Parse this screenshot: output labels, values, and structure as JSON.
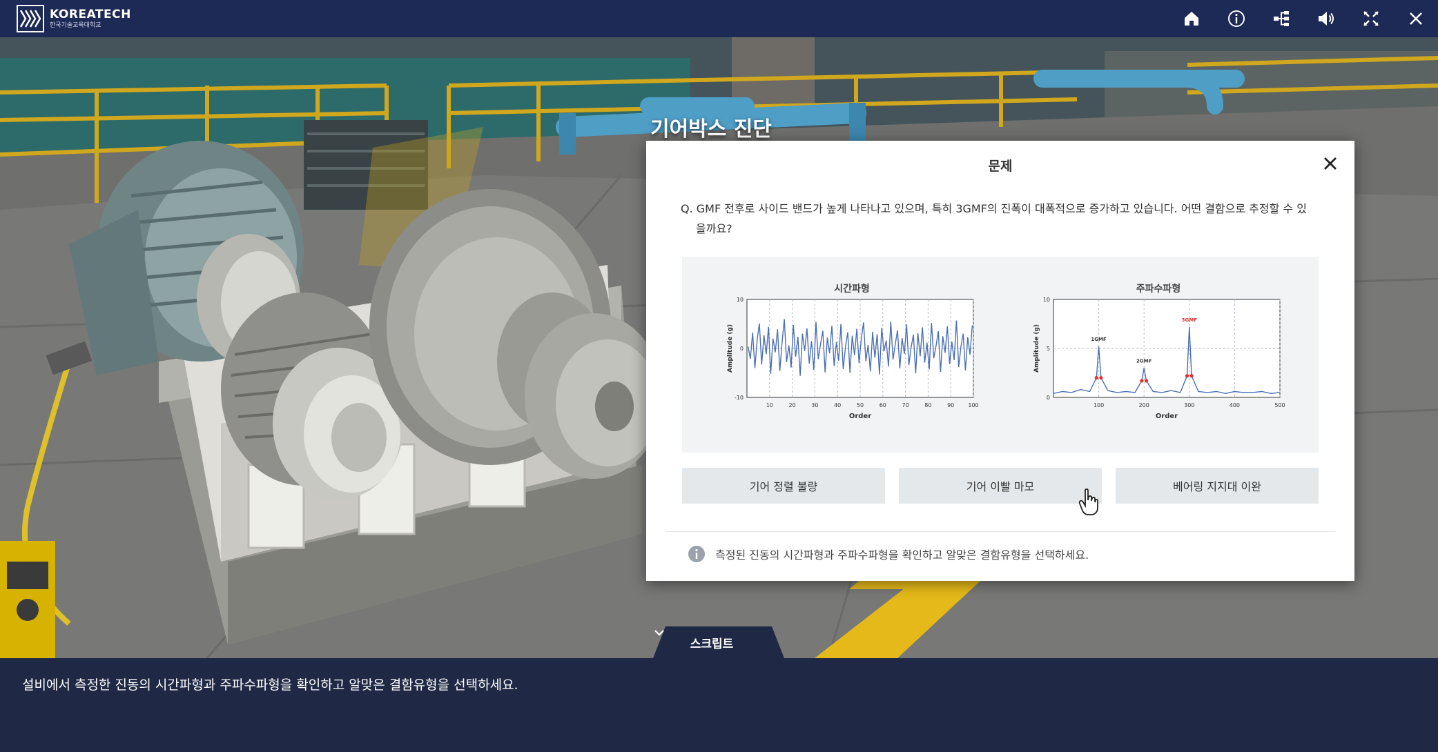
{
  "header": {
    "logo_name": "KOREATECH",
    "logo_sub": "한국기술교육대학교",
    "icons": [
      "home-icon",
      "info-icon",
      "sitemap-icon",
      "volume-icon",
      "fullscreen-icon",
      "close-icon"
    ]
  },
  "scene": {
    "title": "기어박스 진단"
  },
  "dialog": {
    "title": "문제",
    "question": "Q. GMF 전후로 사이드 밴드가 높게 나타나고 있으며, 특히 3GMF의 진폭이 대폭적으로 증가하고 있습니다. 어떤 결함으로 추정할 수 있을까요?",
    "options": [
      "기어 정렬 불량",
      "기어 이빨 마모",
      "베어링 지지대 이완"
    ],
    "hint": "측정된 진동의 시간파형과 주파수파형을 확인하고 알맞은 결함유형을 선택하세요."
  },
  "script": {
    "tab_label": "스크립트",
    "subtitle": "설비에서 측정한 진동의 시간파형과 주파수파형을 확인하고 알맞은 결함유형을 선택하세요."
  },
  "colors": {
    "header_bg": "#1e2a56",
    "signal": "#4a6fb5",
    "peak_marker": "#e03030"
  },
  "chart_data": [
    {
      "type": "line",
      "title": "시간파형",
      "xlabel": "Order",
      "ylabel": "Amplitude (g)",
      "xlim": [
        0,
        100
      ],
      "ylim": [
        -10,
        10
      ],
      "x_ticks": [
        "10",
        "20",
        "30",
        "40",
        "50",
        "60",
        "70",
        "80",
        "90",
        "100"
      ],
      "y_ticks": [
        "10",
        "0",
        "-10"
      ],
      "grid": true,
      "series": [
        {
          "values": [
            0.4,
            -2.1,
            3.2,
            -4.0,
            1.8,
            5.1,
            -3.3,
            2.7,
            -1.2,
            4.4,
            -5.2,
            2.0,
            -0.8,
            3.9,
            -4.6,
            1.1,
            6.0,
            -2.8,
            0.6,
            -3.9,
            4.8,
            -1.7,
            2.4,
            -5.6,
            3.0,
            -0.5,
            4.1,
            -3.1,
            1.5,
            -4.4,
            5.4,
            -2.2,
            0.9,
            3.6,
            -4.9,
            2.2,
            -1.0,
            4.6,
            -3.6,
            1.3,
            -2.5,
            5.0,
            -4.2,
            0.3,
            3.3,
            -5.0,
            2.6,
            -1.4,
            4.0,
            -3.0,
            1.9,
            5.3,
            -2.6,
            0.7,
            -4.7,
            3.4,
            -1.9,
            2.9,
            -5.3,
            4.2,
            -0.6,
            1.6,
            -3.7,
            5.5,
            -2.3,
            0.8,
            3.7,
            -4.1,
            2.1,
            -1.1,
            4.9,
            -3.4,
            0.2,
            2.8,
            -5.1,
            3.1,
            -1.6,
            4.3,
            -2.9,
            1.2,
            -4.3,
            5.2,
            -2.0,
            0.5,
            3.5,
            -4.8,
            2.5,
            -0.9,
            4.5,
            -3.2,
            1.4,
            -2.4,
            5.7,
            -3.8,
            0.4,
            3.0,
            -4.5,
            2.3,
            -1.3,
            4.7
          ]
        }
      ]
    },
    {
      "type": "line",
      "title": "주파수파형",
      "xlabel": "Order",
      "ylabel": "Amplitude (g)",
      "xlim": [
        0,
        500
      ],
      "ylim": [
        0,
        10
      ],
      "x_ticks": [
        "100",
        "200",
        "300",
        "400",
        "500"
      ],
      "y_ticks": [
        "10",
        "5",
        "0"
      ],
      "grid": true,
      "annotations": [
        "1GMF",
        "2GMF",
        "3GMF"
      ],
      "series": [
        {
          "x": [
            0,
            20,
            40,
            60,
            80,
            95,
            100,
            105,
            120,
            140,
            160,
            180,
            195,
            200,
            205,
            220,
            240,
            260,
            280,
            295,
            300,
            305,
            320,
            340,
            360,
            380,
            400,
            420,
            440,
            460,
            480,
            500
          ],
          "values": [
            0.4,
            0.6,
            0.5,
            0.8,
            0.6,
            2.0,
            5.2,
            2.0,
            0.7,
            0.5,
            0.6,
            0.5,
            1.7,
            3.0,
            1.7,
            0.6,
            0.5,
            0.7,
            0.5,
            2.2,
            7.2,
            2.2,
            0.6,
            0.5,
            0.6,
            0.4,
            0.6,
            0.5,
            0.5,
            0.6,
            0.4,
            0.5
          ]
        }
      ]
    }
  ]
}
